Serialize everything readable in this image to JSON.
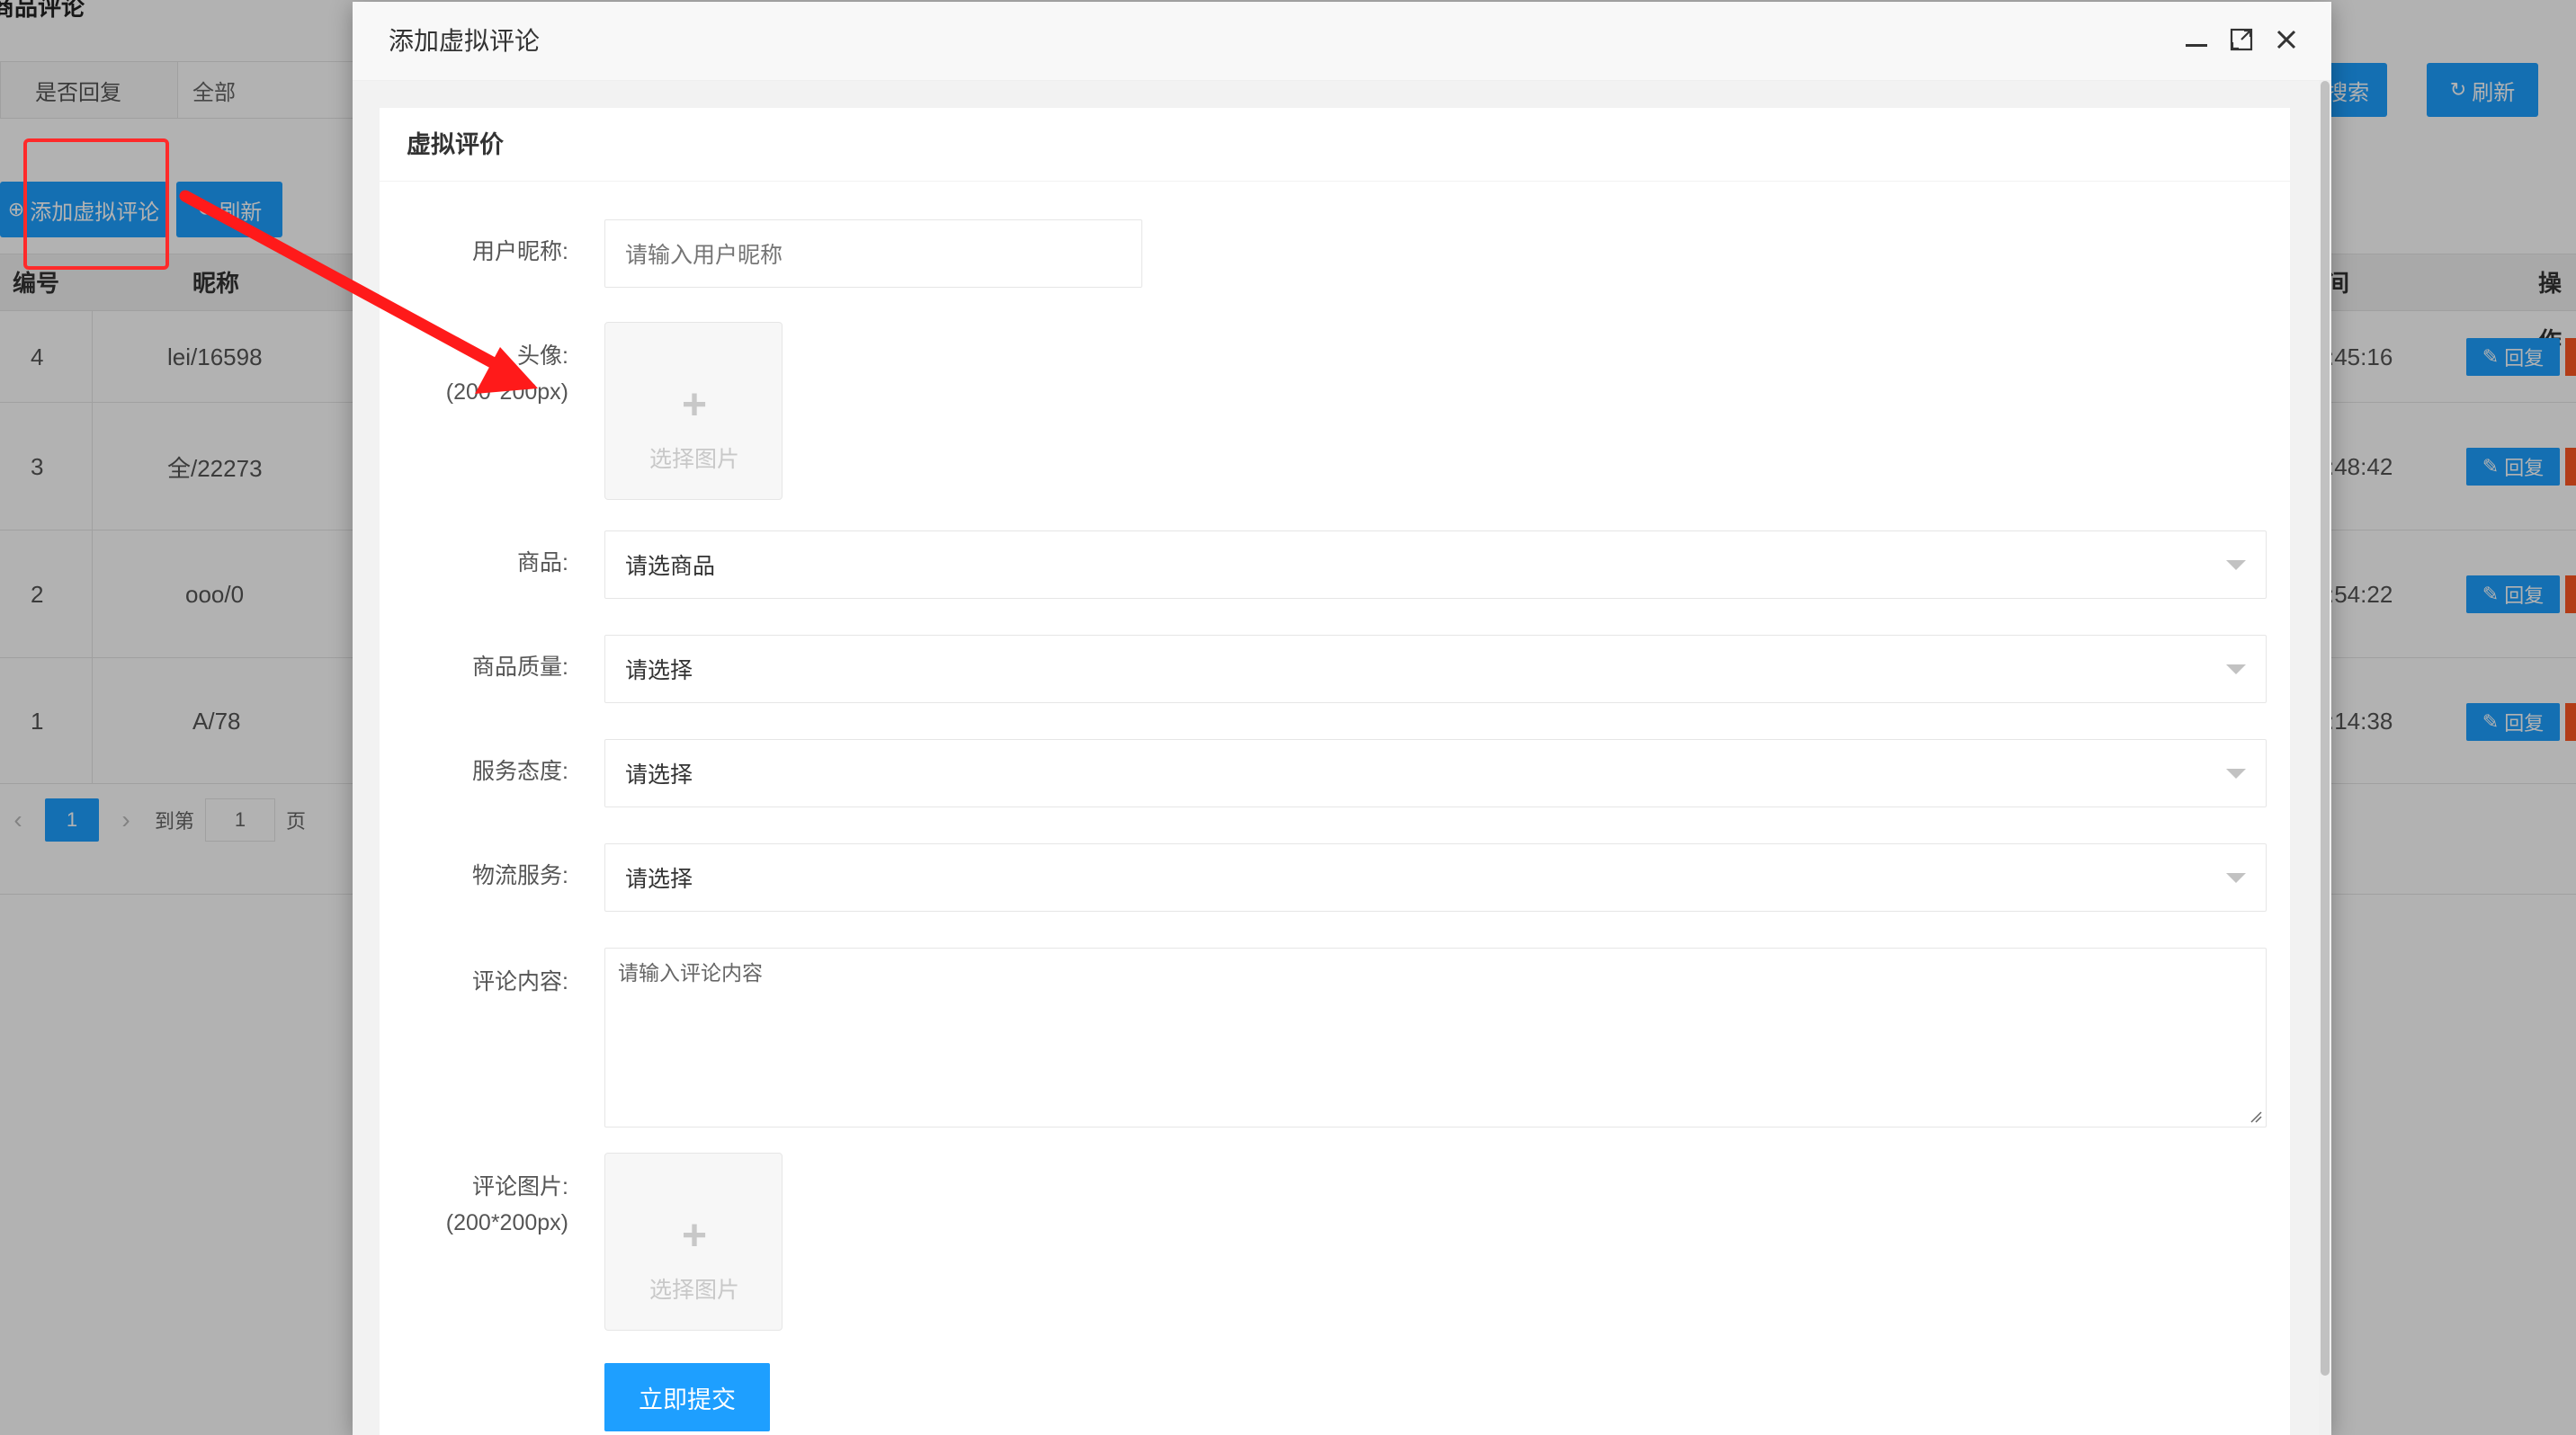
{
  "background": {
    "title": "商品评论",
    "filter": {
      "label": "是否回复",
      "value": "全部"
    },
    "buttons": {
      "add": "添加虚拟评论",
      "refresh": "刷新",
      "search": "搜索",
      "refresh_right": "刷新"
    },
    "table": {
      "headers": {
        "id": "编号",
        "nickname": "昵称",
        "time": "间",
        "ops": "操作"
      },
      "rows": [
        {
          "id": "4",
          "nickname": "lei/16598",
          "time": ":45:16",
          "reply": "回复"
        },
        {
          "id": "3",
          "nickname": "全/22273",
          "time": ":48:42",
          "reply": "回复"
        },
        {
          "id": "2",
          "nickname": "ooo/0",
          "time": ":54:22",
          "reply": "回复"
        },
        {
          "id": "1",
          "nickname": "A/78",
          "time": ":14:38",
          "reply": "回复"
        }
      ]
    },
    "pager": {
      "current": "1",
      "goto_label": "到第",
      "goto_value": "1",
      "page_label": "页"
    }
  },
  "modal": {
    "title": "添加虚拟评论",
    "section_title": "虚拟评价",
    "fields": {
      "nickname": {
        "label": "用户昵称:",
        "placeholder": "请输入用户昵称"
      },
      "avatar": {
        "label": "头像:",
        "hint": "(200*200px)",
        "upload_text": "选择图片"
      },
      "product": {
        "label": "商品:",
        "value": "请选商品"
      },
      "quality": {
        "label": "商品质量:",
        "value": "请选择"
      },
      "service": {
        "label": "服务态度:",
        "value": "请选择"
      },
      "logistics": {
        "label": "物流服务:",
        "value": "请选择"
      },
      "content": {
        "label": "评论内容:",
        "placeholder": "请输入评论内容"
      },
      "images": {
        "label": "评论图片:",
        "hint": "(200*200px)",
        "upload_text": "选择图片"
      }
    },
    "submit": "立即提交"
  },
  "colors": {
    "primary": "#1e9fff",
    "danger": "#ff5722",
    "annotation": "#ff2a2a"
  },
  "icons": [
    "minimize-icon",
    "maximize-icon",
    "close-icon",
    "plus-circle-icon",
    "refresh-icon",
    "search-icon",
    "edit-icon",
    "chevron-left-icon",
    "chevron-right-icon",
    "plus-icon",
    "dropdown-arrow-icon"
  ]
}
